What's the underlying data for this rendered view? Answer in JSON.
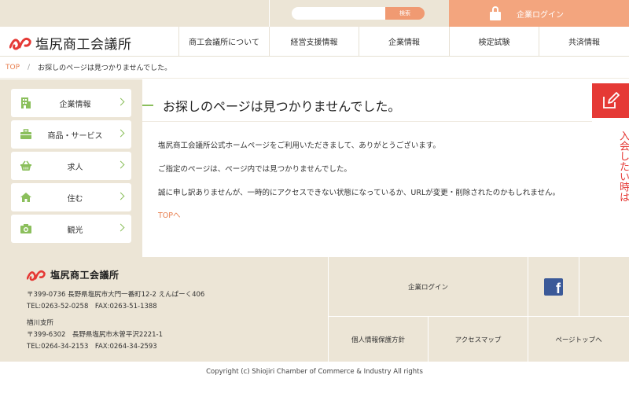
{
  "topbar": {
    "search_placeholder": "",
    "search_button": "検索",
    "login_label": "企業ログイン"
  },
  "header": {
    "logo_text": "塩尻商工会議所",
    "nav": [
      {
        "label": "商工会議所について"
      },
      {
        "label": "経営支援情報"
      },
      {
        "label": "企業情報"
      },
      {
        "label": "検定試験"
      },
      {
        "label": "共済情報"
      }
    ]
  },
  "breadcrumb": {
    "home": "TOP",
    "separator": "/",
    "current": "お探しのページは見つかりませんでした。"
  },
  "sidebar": {
    "items": [
      {
        "label": "企業情報",
        "icon": "building-icon"
      },
      {
        "label": "商品・サービス",
        "icon": "briefcase-icon"
      },
      {
        "label": "求人",
        "icon": "basket-icon"
      },
      {
        "label": "住む",
        "icon": "house-icon"
      },
      {
        "label": "観光",
        "icon": "camera-icon"
      }
    ]
  },
  "main": {
    "title": "お探しのページは見つかりませんでした。",
    "paragraphs": [
      "塩尻商工会議所公式ホームページをご利用いただきまして、ありがとうございます。",
      "ご指定のページは、ページ内では見つかりませんでした。",
      "誠に申し訳ありませんが、一時的にアクセスできない状態になっているか、URLが変更・削除されたのかもしれません。"
    ],
    "top_link": "TOPへ"
  },
  "join_tab": {
    "label": "入会したい時は"
  },
  "footer": {
    "logo_text": "塩尻商工会議所",
    "address_lines": [
      "〒399-0736 長野県塩尻市大門一番町12-2 えんぱーく406",
      "TEL:0263-52-0258　FAX:0263-51-1388",
      "楢川支所",
      "〒399-6302　長野県塩尻市木曽平沢2221-1",
      "TEL:0264-34-2153　FAX:0264-34-2593"
    ],
    "login": "企業ログイン",
    "facebook_letter": "f",
    "privacy": "個人情報保護方針",
    "access": "アクセスマップ",
    "page_top": "ページトップへ"
  },
  "copyright": "Copyright (c) Shiojiri Chamber of Commerce & Industry All rights",
  "colors": {
    "beige": "#ece5d6",
    "orange": "#f3a57e",
    "accent_orange": "#e87f4f",
    "green": "#8bbf5c",
    "red": "#e53935",
    "facebook": "#3b5998"
  }
}
